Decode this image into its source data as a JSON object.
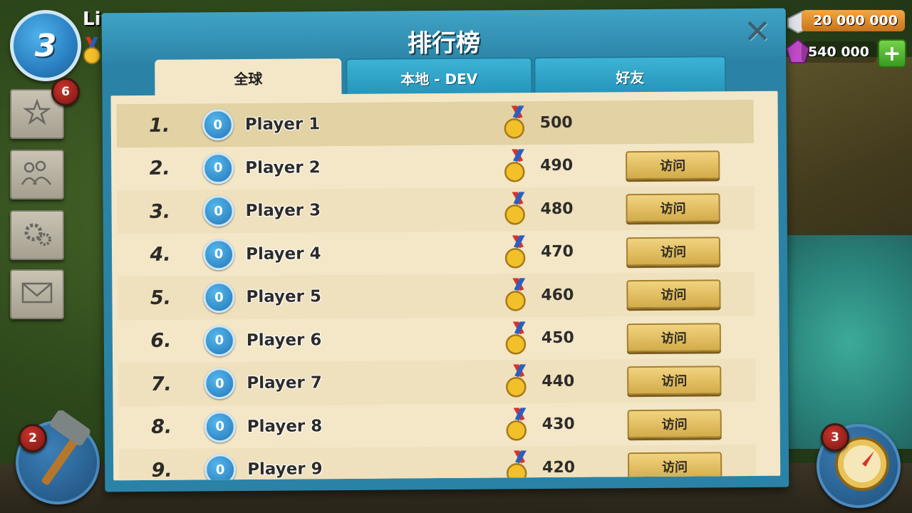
{
  "hud": {
    "level": "3",
    "player_name": "Li",
    "resources": {
      "stone": "20 000 000",
      "gems": "540 000"
    },
    "side_buttons": [
      {
        "name": "sidebar-stars-button",
        "icon": "stars-icon",
        "badge": "6"
      },
      {
        "name": "sidebar-community-button",
        "icon": "people-icon",
        "badge": ""
      },
      {
        "name": "sidebar-settings-button",
        "icon": "gear-icon",
        "badge": ""
      },
      {
        "name": "sidebar-mail-button",
        "icon": "mail-icon",
        "badge": ""
      }
    ],
    "build_badge": "2",
    "map_badge": "3"
  },
  "modal": {
    "title": "排行榜",
    "close": "✕",
    "tabs": [
      {
        "label": "全球",
        "active": true
      },
      {
        "label": "本地 - DEV",
        "active": false
      },
      {
        "label": "好友",
        "active": false
      }
    ],
    "visit_label": "访问",
    "rows": [
      {
        "rank": "1.",
        "level": "0",
        "name": "Player 1",
        "score": "500",
        "visit": false
      },
      {
        "rank": "2.",
        "level": "0",
        "name": "Player 2",
        "score": "490",
        "visit": true
      },
      {
        "rank": "3.",
        "level": "0",
        "name": "Player 3",
        "score": "480",
        "visit": true
      },
      {
        "rank": "4.",
        "level": "0",
        "name": "Player 4",
        "score": "470",
        "visit": true
      },
      {
        "rank": "5.",
        "level": "0",
        "name": "Player 5",
        "score": "460",
        "visit": true
      },
      {
        "rank": "6.",
        "level": "0",
        "name": "Player 6",
        "score": "450",
        "visit": true
      },
      {
        "rank": "7.",
        "level": "0",
        "name": "Player 7",
        "score": "440",
        "visit": true
      },
      {
        "rank": "8.",
        "level": "0",
        "name": "Player 8",
        "score": "430",
        "visit": true
      },
      {
        "rank": "9.",
        "level": "0",
        "name": "Player 9",
        "score": "420",
        "visit": true
      }
    ]
  },
  "colors": {
    "modal_blue": "#2a83a6",
    "paper": "#f3e7c8",
    "visit_gold": "#e6c163"
  }
}
